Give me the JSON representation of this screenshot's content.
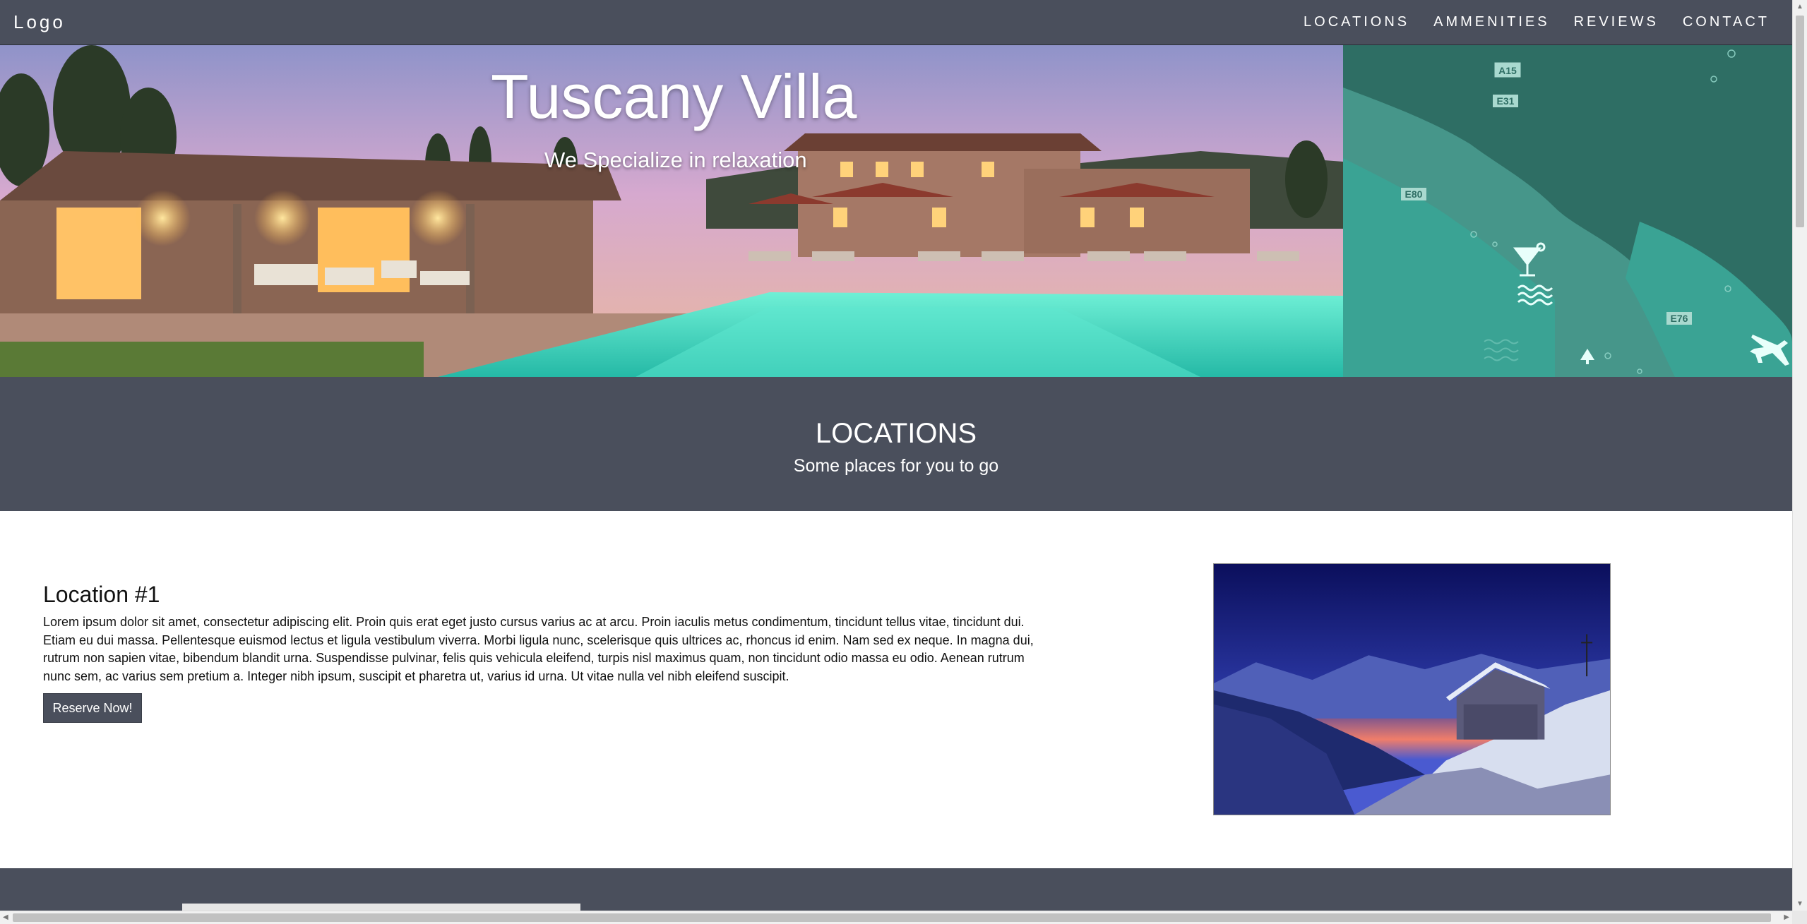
{
  "nav": {
    "logo": "Logo",
    "links": [
      "LOCATIONS",
      "AMMENITIES",
      "REVIEWS",
      "CONTACT"
    ]
  },
  "hero": {
    "title": "Tuscany Villa",
    "subtitle": "We Specialize in relaxation",
    "map_labels": [
      "A15",
      "E31",
      "E80",
      "E76"
    ]
  },
  "locations_band": {
    "heading": "LOCATIONS",
    "subheading": "Some places for you to go"
  },
  "location1": {
    "title": "Location #1",
    "description": "Lorem ipsum dolor sit amet, consectetur adipiscing elit. Proin quis erat eget justo cursus varius ac at arcu. Proin iaculis metus condimentum, tincidunt tellus vitae, tincidunt dui. Etiam eu dui massa. Pellentesque euismod lectus et ligula vestibulum viverra. Morbi ligula nunc, scelerisque quis ultrices ac, rhoncus id enim. Nam sed ex neque. In magna dui, rutrum non sapien vitae, bibendum blandit urna. Suspendisse pulvinar, felis quis vehicula eleifend, turpis nisl maximus quam, non tincidunt odio massa eu odio. Aenean rutrum nunc sem, ac varius sem pretium a. Integer nibh ipsum, suscipit et pharetra ut, varius id urna. Ut vitae nulla vel nibh eleifend suscipit.",
    "button_label": "Reserve Now!"
  },
  "colors": {
    "nav_bg": "#4a4f5c",
    "map_teal": "#3aa394",
    "pool": "#3fe0c8"
  },
  "icons": [
    "cocktail-icon",
    "waves-icon",
    "airplane-icon",
    "tree-icon"
  ]
}
